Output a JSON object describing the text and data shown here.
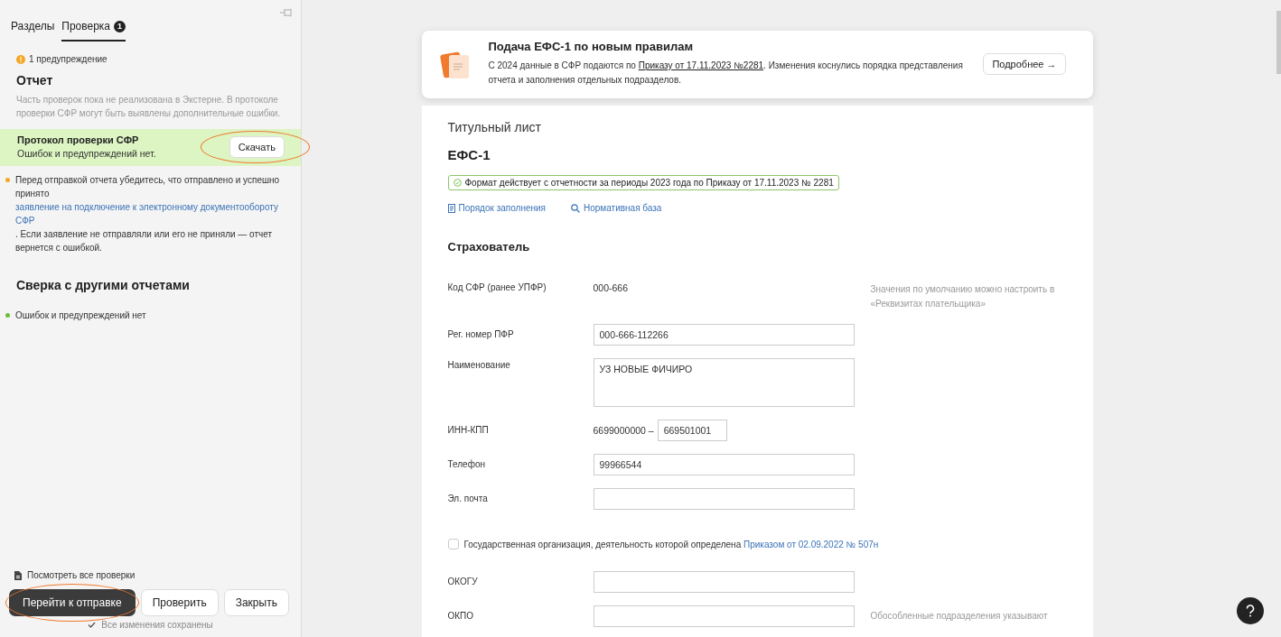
{
  "sidebar": {
    "tabs": [
      {
        "label": "Разделы",
        "selected": false
      },
      {
        "label": "Проверка",
        "selected": true,
        "badge": "1"
      }
    ],
    "warning": "1 предупреждение",
    "report": {
      "title": "Отчет",
      "note": "Часть проверок пока не реализована в Экстерне. В протоколе проверки СФР могут быть выявлены дополнительные ошибки.",
      "protocol": {
        "title": "Протокол проверки СФР",
        "status": "Ошибок и предупреждений нет.",
        "button": "Скачать",
        "highlighted": true
      },
      "notice": {
        "color": "#f5a623",
        "before": "Перед отправкой отчета убедитесь, что отправлено и успешно принято ",
        "link": "заявление на подключение к электронному документообороту СФР",
        "after": ". Если заявление не отправляли или его не приняли — отчет вернется с ошибкой."
      }
    },
    "reconciliation": {
      "title": "Сверка с другими отчетами",
      "status": "Ошибок и предупреждений нет",
      "color": "#6bbf3a"
    },
    "view_all": "Посмотреть все проверки",
    "buttons": [
      {
        "label": "Перейти к отправке",
        "kind": "primary",
        "highlighted": true
      },
      {
        "label": "Проверить",
        "kind": "secondary",
        "highlighted": false
      },
      {
        "label": "Закрыть",
        "kind": "secondary",
        "highlighted": false
      }
    ],
    "saved": "Все изменения сохранены"
  },
  "banner": {
    "title": "Подача ЕФС-1 по новым правилам",
    "before": "С 2024 данные в СФР подаются по ",
    "link": "Приказу от 17.11.2023 №2281",
    "after": ". Изменения коснулись порядка представления отчета и заполнения отдельных подразделов.",
    "button": "Подробнее →"
  },
  "document": {
    "section": "Титульный лист",
    "form": "ЕФС-1",
    "format": "Формат действует с отчетности за периоды 2023 года по Приказу от 17.11.2023 № 2281",
    "links": [
      {
        "label": "Порядок заполнения",
        "kind": "doc"
      },
      {
        "label": "Нормативная база",
        "kind": "search"
      }
    ],
    "heading": "Страхователь",
    "fields": [
      {
        "kind": "text",
        "label": "Код СФР (ранее УПФР)",
        "value": "000-666",
        "hint": "Значения по умолчанию можно настроить в «Реквизитах плательщика»"
      },
      {
        "kind": "input",
        "label": "Рег. номер ПФР",
        "value": "000-666-112266"
      },
      {
        "kind": "textarea",
        "label": "Наименование",
        "value": "УЗ НОВЫЕ ФИЧИРО"
      },
      {
        "kind": "split",
        "label": "ИНН-КПП",
        "prefix": "6699000000 –",
        "value": "669501001"
      },
      {
        "kind": "input",
        "label": "Телефон",
        "value": "99966544"
      },
      {
        "kind": "input",
        "label": "Эл. почта"
      },
      {
        "kind": "checkbox",
        "label": "Государственная организация, деятельность которой определена ",
        "link": "Приказом от 02.09.2022 № 507н",
        "checked": false
      },
      {
        "kind": "input",
        "label": "ОКОГУ"
      },
      {
        "kind": "input",
        "label": "ОКПО",
        "hint": "Обособленные подразделения указывают"
      }
    ]
  }
}
